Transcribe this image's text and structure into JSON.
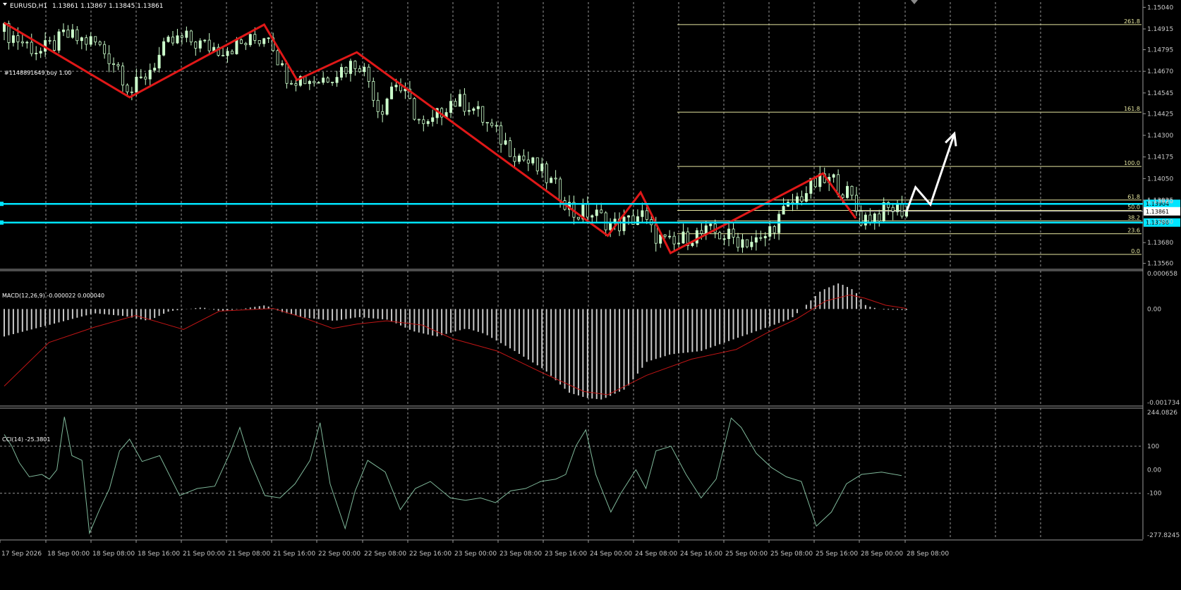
{
  "header": {
    "symbol": "EURUSD,H1",
    "ohlc": "1.13861 1.13867 1.13845 1.13861",
    "order_label": "#1148891649 buy 1.00"
  },
  "colors": {
    "background": "#000000",
    "bull_candle": "#ccffcc",
    "bear_candle": "#ccffcc",
    "zigzag": "#e01818",
    "fib": "#e6e6a0",
    "levels": "#00e5ff",
    "macd_hist": "#c8c8c8",
    "macd_signal": "#c01515",
    "cci_line": "#7fb89a",
    "arrow": "#ffffff",
    "grid": "#c8c8c8"
  },
  "chart_data": [
    {
      "type": "candlestick",
      "name": "price",
      "ylim": [
        1.1353,
        1.1507
      ],
      "y_ticks": [
        "1.15040",
        "1.14915",
        "1.14795",
        "1.14670",
        "1.14545",
        "1.14425",
        "1.14300",
        "1.14175",
        "1.14050",
        "1.13925",
        "1.13680",
        "1.13560"
      ],
      "y_tick_values": [
        1.1504,
        1.14915,
        1.14795,
        1.1467,
        1.14545,
        1.14425,
        1.143,
        1.14175,
        1.1405,
        1.13925,
        1.1368,
        1.1356
      ],
      "x_ticks": [
        "17 Sep 2026",
        "18 Sep 00:00",
        "18 Sep 08:00",
        "18 Sep 16:00",
        "21 Sep 00:00",
        "21 Sep 08:00",
        "21 Sep 16:00",
        "22 Sep 00:00",
        "22 Sep 08:00",
        "22 Sep 16:00",
        "23 Sep 00:00",
        "23 Sep 08:00",
        "23 Sep 16:00",
        "24 Sep 00:00",
        "24 Sep 08:00",
        "24 Sep 16:00",
        "25 Sep 00:00",
        "25 Sep 08:00",
        "25 Sep 16:00",
        "28 Sep 00:00",
        "28 Sep 08:00"
      ],
      "n_bars": 199,
      "zigzag": [
        [
          0,
          1.1495
        ],
        [
          42,
          1.1452
        ],
        [
          87,
          1.1494
        ],
        [
          98,
          1.1462
        ],
        [
          118,
          1.1478
        ],
        [
          202,
          1.1372
        ],
        [
          213,
          1.1397
        ],
        [
          223,
          1.1362
        ],
        [
          274,
          1.1408
        ],
        [
          285,
          1.1382
        ]
      ],
      "close_path": [
        [
          0,
          1.149
        ],
        [
          8,
          1.1482
        ],
        [
          12,
          1.1478
        ],
        [
          18,
          1.1484
        ],
        [
          20,
          1.1488
        ],
        [
          25,
          1.1485
        ],
        [
          30,
          1.1484
        ],
        [
          38,
          1.147
        ],
        [
          42,
          1.1455
        ],
        [
          45,
          1.146
        ],
        [
          50,
          1.1472
        ],
        [
          55,
          1.1483
        ],
        [
          60,
          1.1486
        ],
        [
          66,
          1.1482
        ],
        [
          72,
          1.148
        ],
        [
          78,
          1.1482
        ],
        [
          85,
          1.1486
        ],
        [
          88,
          1.149
        ],
        [
          93,
          1.1466
        ],
        [
          98,
          1.1463
        ],
        [
          105,
          1.1462
        ],
        [
          112,
          1.1468
        ],
        [
          118,
          1.1473
        ],
        [
          122,
          1.146
        ],
        [
          125,
          1.1443
        ],
        [
          130,
          1.1462
        ],
        [
          135,
          1.1448
        ],
        [
          140,
          1.1433
        ],
        [
          143,
          1.1438
        ],
        [
          148,
          1.145
        ],
        [
          155,
          1.1448
        ],
        [
          162,
          1.1434
        ],
        [
          170,
          1.142
        ],
        [
          178,
          1.141
        ],
        [
          185,
          1.1397
        ],
        [
          190,
          1.1384
        ],
        [
          193,
          1.1386
        ],
        [
          198,
          1.1383
        ],
        [
          203,
          1.1378
        ],
        [
          208,
          1.138
        ],
        [
          212,
          1.1385
        ],
        [
          215,
          1.1375
        ],
        [
          220,
          1.1368
        ],
        [
          223,
          1.1366
        ],
        [
          228,
          1.1372
        ],
        [
          236,
          1.1374
        ],
        [
          244,
          1.137
        ],
        [
          252,
          1.1368
        ],
        [
          256,
          1.1378
        ],
        [
          262,
          1.139
        ],
        [
          270,
          1.1402
        ],
        [
          276,
          1.1404
        ],
        [
          282,
          1.1394
        ],
        [
          285,
          1.1382
        ],
        [
          290,
          1.1384
        ],
        [
          296,
          1.1388
        ],
        [
          302,
          1.1386
        ]
      ],
      "fibonacci": {
        "levels": [
          "261.8",
          "161.8",
          "100.0",
          "61.8",
          "50.0",
          "38.2",
          "23.6",
          "0.0"
        ],
        "prices": [
          1.1494,
          1.14434,
          1.1412,
          1.13926,
          1.13866,
          1.13806,
          1.13731,
          1.13612
        ]
      },
      "horizontal_lines": [
        {
          "label": "1.13904",
          "price": 1.13904
        },
        {
          "label": "1.13796",
          "price": 1.13796
        }
      ],
      "current_price": "1.13861",
      "extra_price_labels": [
        "1.13920",
        "1.13800"
      ],
      "forecast_arrow": [
        [
          302,
          1.1386
        ],
        [
          305,
          1.14
        ],
        [
          310,
          1.139
        ],
        [
          318,
          1.1431
        ]
      ]
    },
    {
      "type": "bar",
      "name": "macd",
      "title": "MACD(12,26,9) -0.000022 0.000040",
      "ylim": [
        -0.001734,
        0.000658
      ],
      "y_ticks": [
        "0.000658",
        "0.00",
        "-0.001734"
      ],
      "y_tick_values": [
        0.000658,
        0.0,
        -0.001734
      ],
      "hist_path": [
        [
          0,
          -0.00051
        ],
        [
          30,
          -8e-05
        ],
        [
          40,
          -0.00013
        ],
        [
          48,
          -0.00022
        ],
        [
          55,
          -4e-05
        ],
        [
          66,
          3e-05
        ],
        [
          72,
          -4e-05
        ],
        [
          80,
          1e-05
        ],
        [
          87,
          7e-05
        ],
        [
          92,
          -5e-05
        ],
        [
          100,
          -0.00016
        ],
        [
          110,
          -0.00022
        ],
        [
          118,
          -0.00015
        ],
        [
          128,
          -0.0002
        ],
        [
          136,
          -0.00041
        ],
        [
          144,
          -0.00051
        ],
        [
          154,
          -0.00036
        ],
        [
          160,
          -0.00046
        ],
        [
          170,
          -0.00078
        ],
        [
          180,
          -0.00113
        ],
        [
          188,
          -0.00155
        ],
        [
          194,
          -0.00165
        ],
        [
          199,
          -0.00168
        ],
        [
          207,
          -0.00148
        ],
        [
          214,
          -0.00098
        ],
        [
          222,
          -0.00084
        ],
        [
          232,
          -0.00078
        ],
        [
          242,
          -0.00058
        ],
        [
          252,
          -0.00038
        ],
        [
          262,
          -0.00018
        ],
        [
          266,
          2e-05
        ],
        [
          272,
          0.00034
        ],
        [
          278,
          0.00048
        ],
        [
          283,
          0.00035
        ],
        [
          287,
          6e-05
        ],
        [
          292,
          -1e-05
        ],
        [
          302,
          -2e-05
        ]
      ],
      "signal_path": [
        [
          0,
          -0.00143
        ],
        [
          15,
          -0.00062
        ],
        [
          30,
          -0.00034
        ],
        [
          44,
          -0.00012
        ],
        [
          60,
          -0.00038
        ],
        [
          72,
          -4e-05
        ],
        [
          90,
          1e-05
        ],
        [
          100,
          -0.00016
        ],
        [
          110,
          -0.00036
        ],
        [
          118,
          -0.00028
        ],
        [
          128,
          -0.00022
        ],
        [
          140,
          -0.0003
        ],
        [
          150,
          -0.00055
        ],
        [
          165,
          -0.00078
        ],
        [
          180,
          -0.00118
        ],
        [
          194,
          -0.00153
        ],
        [
          202,
          -0.00159
        ],
        [
          215,
          -0.00123
        ],
        [
          230,
          -0.00093
        ],
        [
          245,
          -0.00075
        ],
        [
          255,
          -0.00045
        ],
        [
          265,
          -0.00019
        ],
        [
          275,
          0.00015
        ],
        [
          283,
          0.00026
        ],
        [
          288,
          0.0002
        ],
        [
          295,
          7e-05
        ],
        [
          302,
          1e-05
        ]
      ]
    },
    {
      "type": "line",
      "name": "cci",
      "title": "CCI(14) -25.3801",
      "ylim": [
        -277.8245,
        244.0826
      ],
      "y_ticks": [
        "244.0826",
        "100",
        "0.00",
        "-100",
        "-277.8245"
      ],
      "y_tick_values": [
        244.0826,
        100,
        0,
        -100,
        -277.8245
      ],
      "levels": [
        100,
        -100
      ],
      "values_path": [
        [
          0,
          150
        ],
        [
          3,
          100
        ],
        [
          6,
          30
        ],
        [
          10,
          -30
        ],
        [
          15,
          -20
        ],
        [
          18,
          -40
        ],
        [
          21,
          0
        ],
        [
          24,
          225
        ],
        [
          27,
          60
        ],
        [
          31,
          40
        ],
        [
          34,
          -270
        ],
        [
          38,
          -170
        ],
        [
          42,
          -80
        ],
        [
          46,
          80
        ],
        [
          50,
          130
        ],
        [
          55,
          35
        ],
        [
          62,
          60
        ],
        [
          70,
          -110
        ],
        [
          77,
          -80
        ],
        [
          84,
          -70
        ],
        [
          90,
          70
        ],
        [
          94,
          180
        ],
        [
          98,
          40
        ],
        [
          104,
          -110
        ],
        [
          110,
          -120
        ],
        [
          116,
          -60
        ],
        [
          122,
          40
        ],
        [
          126,
          200
        ],
        [
          130,
          -60
        ],
        [
          136,
          -250
        ],
        [
          140,
          -90
        ],
        [
          145,
          40
        ],
        [
          152,
          -10
        ],
        [
          158,
          -170
        ],
        [
          164,
          -80
        ],
        [
          170,
          -50
        ],
        [
          178,
          -120
        ],
        [
          184,
          -130
        ],
        [
          190,
          -120
        ],
        [
          196,
          -140
        ],
        [
          202,
          -90
        ],
        [
          208,
          -80
        ],
        [
          214,
          -50
        ],
        [
          220,
          -40
        ],
        [
          224,
          -20
        ],
        [
          228,
          100
        ],
        [
          232,
          170
        ],
        [
          236,
          -20
        ],
        [
          242,
          -180
        ],
        [
          246,
          -100
        ],
        [
          252,
          0
        ],
        [
          256,
          -80
        ],
        [
          260,
          80
        ],
        [
          266,
          100
        ],
        [
          272,
          -20
        ],
        [
          278,
          -120
        ],
        [
          284,
          -40
        ],
        [
          290,
          220
        ],
        [
          294,
          180
        ],
        [
          300,
          70
        ],
        [
          306,
          10
        ],
        [
          312,
          -30
        ],
        [
          318,
          -50
        ],
        [
          324,
          -240
        ],
        [
          330,
          -180
        ],
        [
          336,
          -60
        ],
        [
          342,
          -20
        ],
        [
          350,
          -10
        ],
        [
          358,
          -25
        ]
      ]
    }
  ]
}
